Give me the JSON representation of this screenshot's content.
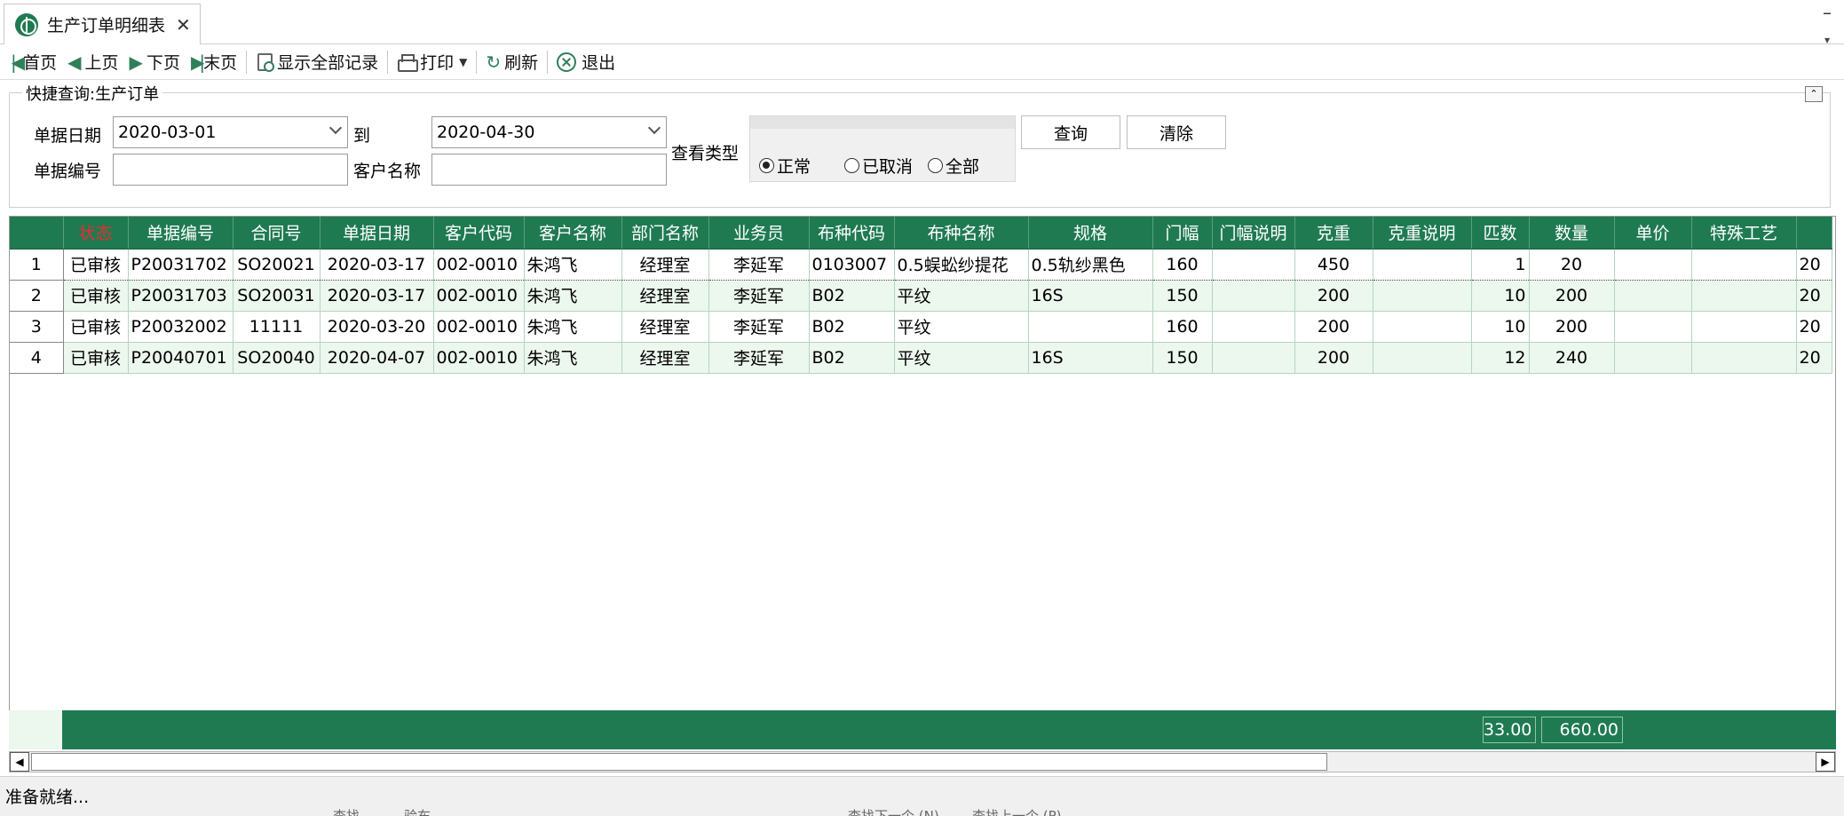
{
  "tab": {
    "title": "生产订单明细表",
    "close": "✕"
  },
  "window": {
    "close": "–"
  },
  "toolbar": {
    "first": "首页",
    "prev": "上页",
    "next": "下页",
    "last": "末页",
    "show_all": "显示全部记录",
    "print": "打印",
    "refresh": "刷新",
    "exit": "退出"
  },
  "query": {
    "title": "快捷查询:生产订单",
    "collapse": "⌃",
    "date_label": "单据日期",
    "date_from": "2020-03-01",
    "to_label": "到",
    "date_to": "2020-04-30",
    "no_label": "单据编号",
    "no_value": "",
    "customer_label": "客户名称",
    "customer_value": "",
    "view_type_label": "查看类型",
    "radios": [
      "正常",
      "已取消",
      "全部"
    ],
    "radio_selected": 0,
    "search_btn": "查询",
    "clear_btn": "清除"
  },
  "grid": {
    "columns": [
      "状态",
      "单据编号",
      "合同号",
      "单据日期",
      "客户代码",
      "客户名称",
      "部门名称",
      "业务员",
      "布种代码",
      "布种名称",
      "规格",
      "门幅",
      "门幅说明",
      "克重",
      "克重说明",
      "匹数",
      "数量",
      "单价",
      "特殊工艺"
    ],
    "rows": [
      {
        "rn": "1",
        "cells": [
          "已审核",
          "P20031702",
          "SO20021",
          "2020-03-17",
          "002-0010",
          "朱鸿飞",
          "经理室",
          "李延军",
          "0103007",
          "0.5蜈蚣纱提花",
          "0.5轨纱黑色",
          "160",
          "",
          "450",
          "",
          "1",
          "20",
          "",
          "",
          "20"
        ]
      },
      {
        "rn": "2",
        "cells": [
          "已审核",
          "P20031703",
          "SO20031",
          "2020-03-17",
          "002-0010",
          "朱鸿飞",
          "经理室",
          "李延军",
          "B02",
          "平纹",
          "16S",
          "150",
          "",
          "200",
          "",
          "10",
          "200",
          "",
          "",
          "20"
        ]
      },
      {
        "rn": "3",
        "cells": [
          "已审核",
          "P20032002",
          "11111",
          "2020-03-20",
          "002-0010",
          "朱鸿飞",
          "经理室",
          "李延军",
          "B02",
          "平纹",
          "",
          "160",
          "",
          "200",
          "",
          "10",
          "200",
          "",
          "",
          "20"
        ]
      },
      {
        "rn": "4",
        "cells": [
          "已审核",
          "P20040701",
          "SO20040",
          "2020-04-07",
          "002-0010",
          "朱鸿飞",
          "经理室",
          "李延军",
          "B02",
          "平纹",
          "16S",
          "150",
          "",
          "200",
          "",
          "12",
          "240",
          "",
          "",
          "20"
        ]
      }
    ],
    "totals": {
      "pieces": "33.00",
      "quantity": "660.00"
    }
  },
  "status": {
    "text": "准备就绪..."
  },
  "background_fragments": [
    "查找",
    "验布",
    "查找下一个 (N)",
    "查找上一个 (P)"
  ]
}
